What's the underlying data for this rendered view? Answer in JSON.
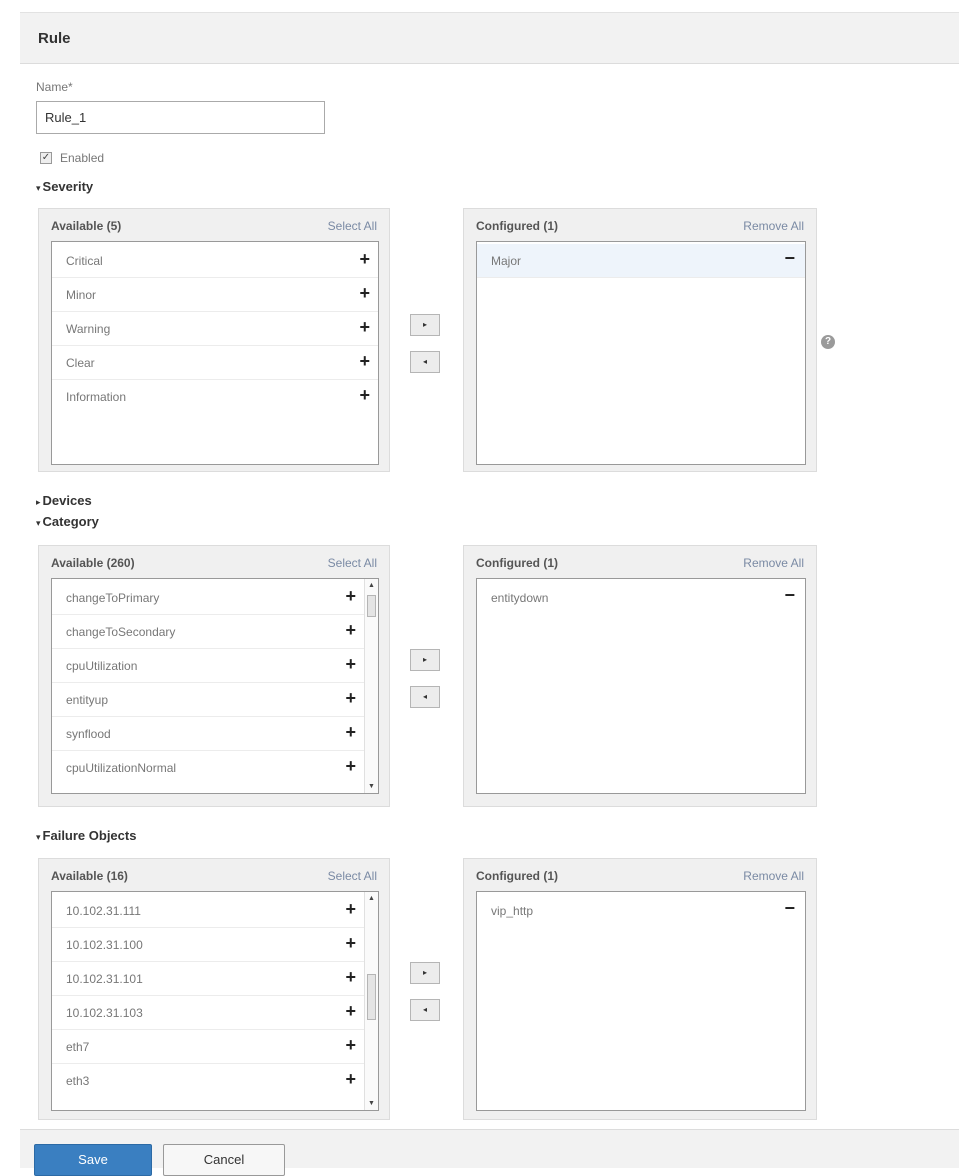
{
  "header": {
    "title": "Rule"
  },
  "form": {
    "name_label": "Name*",
    "name_value": "Rule_1",
    "enabled_label": "Enabled",
    "enabled_checked": true
  },
  "severity": {
    "section_label": "Severity",
    "expanded": true,
    "available_header": "Available (5)",
    "select_all": "Select All",
    "available_items": [
      "Critical",
      "Minor",
      "Warning",
      "Clear",
      "Information"
    ],
    "configured_header": "Configured (1)",
    "remove_all": "Remove All",
    "configured_items": [
      "Major"
    ]
  },
  "devices": {
    "section_label": "Devices",
    "expanded": false
  },
  "category": {
    "section_label": "Category",
    "expanded": true,
    "available_header": "Available (260)",
    "select_all": "Select All",
    "available_items": [
      "changeToPrimary",
      "changeToSecondary",
      "cpuUtilization",
      "entityup",
      "synflood",
      "cpuUtilizationNormal"
    ],
    "configured_header": "Configured (1)",
    "remove_all": "Remove All",
    "configured_items": [
      "entitydown"
    ]
  },
  "failure_objects": {
    "section_label": "Failure Objects",
    "expanded": true,
    "available_header": "Available (16)",
    "select_all": "Select All",
    "available_items": [
      "10.102.31.111",
      "10.102.31.100",
      "10.102.31.101",
      "10.102.31.103",
      "eth7",
      "eth3"
    ],
    "configured_header": "Configured (1)",
    "remove_all": "Remove All",
    "configured_items": [
      "vip_http"
    ]
  },
  "icons": {
    "plus": "+",
    "minus": "−",
    "move_right": "▸",
    "move_left": "◂",
    "expand_down": "▾",
    "collapsed_right": "▸",
    "scroll_up": "▲",
    "scroll_down": "▼",
    "help": "?",
    "check": "✓"
  },
  "footer": {
    "save_label": "Save",
    "cancel_label": "Cancel"
  },
  "colors": {
    "primary_button": "#3a7fc1",
    "panel_bg": "#f0f0f0",
    "selected_row": "#eef4fb"
  }
}
